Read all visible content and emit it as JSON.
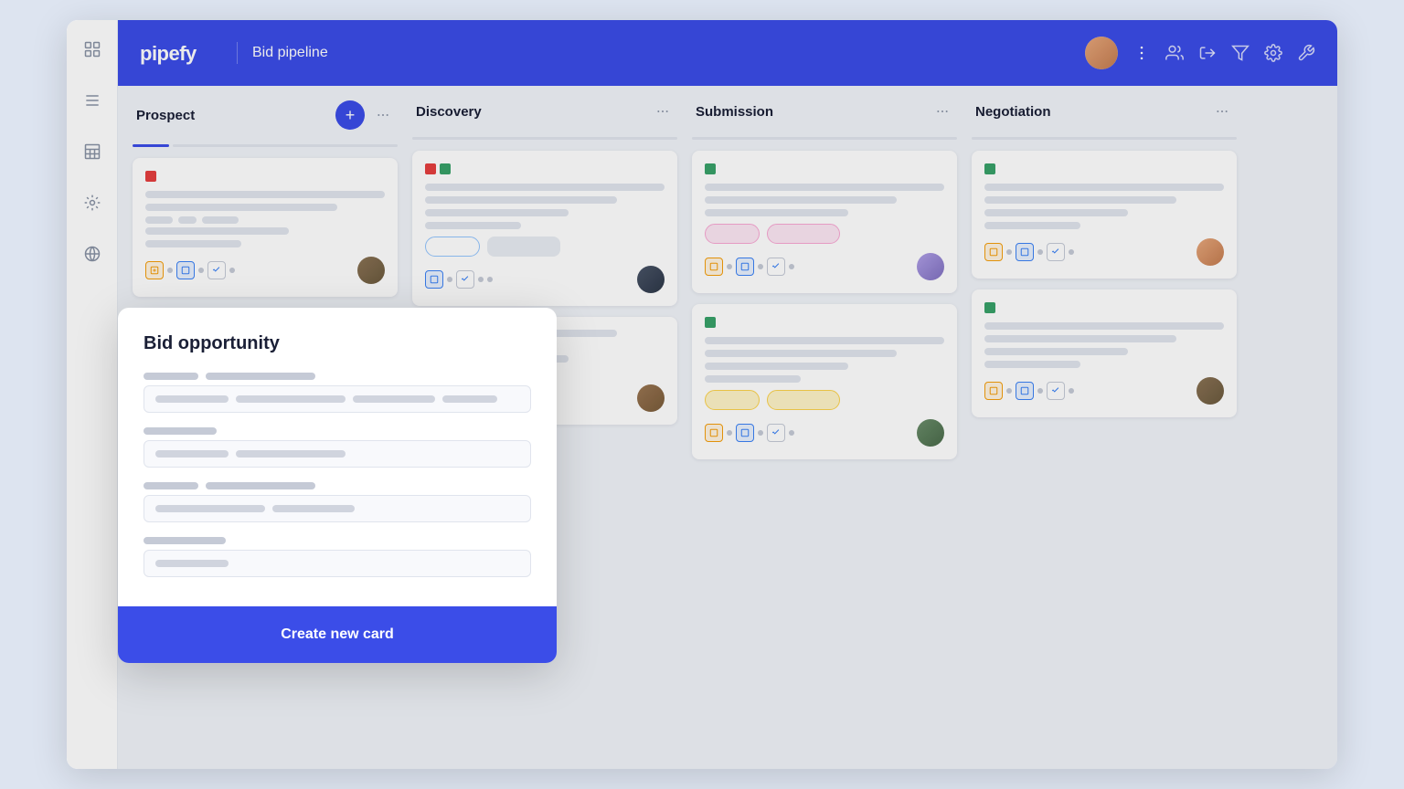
{
  "app": {
    "title": "Bid pipeline",
    "logo": "pipefy"
  },
  "header": {
    "title": "Bid pipeline",
    "icons": [
      "users-icon",
      "login-icon",
      "filter-icon",
      "settings-icon",
      "wrench-icon"
    ],
    "more_icon": "ellipsis-icon"
  },
  "sidebar": {
    "icons": [
      {
        "name": "grid-icon",
        "symbol": "⊞"
      },
      {
        "name": "list-icon",
        "symbol": "≡"
      },
      {
        "name": "table-icon",
        "symbol": "▤"
      },
      {
        "name": "robot-icon",
        "symbol": "🤖"
      },
      {
        "name": "globe-icon",
        "symbol": "🌐"
      }
    ]
  },
  "columns": [
    {
      "id": "prospect",
      "title": "Prospect",
      "has_add": true,
      "progress_color": "blue"
    },
    {
      "id": "discovery",
      "title": "Discovery",
      "has_add": false,
      "progress_color": "gray"
    },
    {
      "id": "submission",
      "title": "Submission",
      "has_add": false,
      "progress_color": "gray"
    },
    {
      "id": "negotiation",
      "title": "Negotiation",
      "has_add": false,
      "progress_color": "gray"
    }
  ],
  "modal": {
    "title": "Bid opportunity",
    "field1": {
      "label_parts": [
        60,
        120
      ],
      "input_parts": [
        80,
        120,
        90,
        60
      ]
    },
    "field2": {
      "label_parts": [
        80
      ],
      "input_parts": [
        80,
        120
      ]
    },
    "field3": {
      "label_parts": [
        60,
        120
      ],
      "input_parts": [
        120,
        90
      ]
    },
    "field4": {
      "label_parts": [
        90
      ],
      "input_parts": [
        80
      ]
    },
    "create_btn": "Create new card"
  }
}
